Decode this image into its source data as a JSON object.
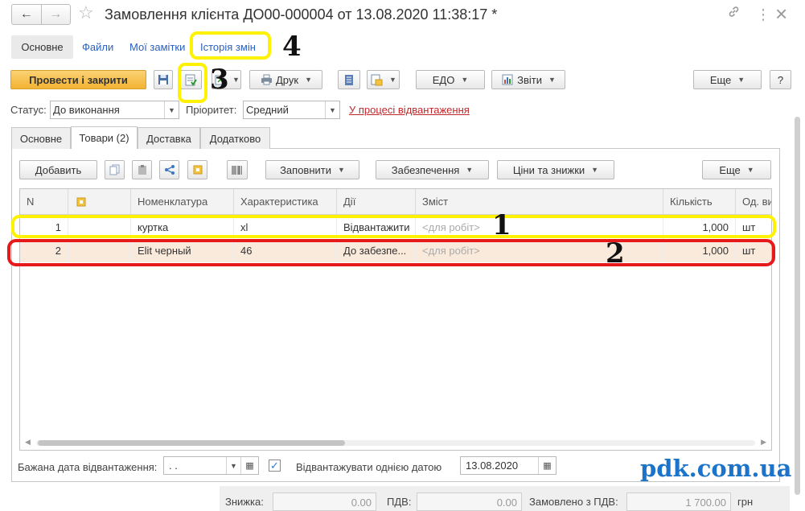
{
  "window": {
    "title": "Замовлення клієнта ДО00-000004 от 13.08.2020 11:38:17 *",
    "back_icon": "←",
    "forward_icon": "→",
    "star_icon": "☆",
    "link_icon": "🔗",
    "more_icon": "⋮",
    "close_icon": "×"
  },
  "panel_tabs": [
    {
      "label": "Основне"
    },
    {
      "label": "Файли"
    },
    {
      "label": "Мої замітки"
    },
    {
      "label": "Історія змін"
    }
  ],
  "toolbar": {
    "post_close": "Провести і закрити",
    "print": "Друк",
    "edo": "ЕДО",
    "reports": "Звіти",
    "more": "Еще",
    "help": "?"
  },
  "status_row": {
    "status_label": "Статус:",
    "status_value": "До виконання",
    "priority_label": "Пріоритет:",
    "priority_value": "Средний",
    "shipping_link": "У процесі відвантаження"
  },
  "form_tabs": [
    {
      "label": "Основне"
    },
    {
      "label": "Товари (2)"
    },
    {
      "label": "Доставка"
    },
    {
      "label": "Додатково"
    }
  ],
  "goods_toolbar": {
    "add": "Добавить",
    "fill": "Заповнити",
    "provision": "Забезпечення",
    "prices": "Ціни та знижки",
    "more": "Еще"
  },
  "table": {
    "columns": [
      "N",
      "",
      "Номенклатура",
      "Характеристика",
      "Дії",
      "Зміст",
      "Кількість",
      "Од. ви"
    ],
    "rows": [
      {
        "n": "1",
        "item": "куртка",
        "char": "xl",
        "action": "Відвантажити",
        "content": "<для робіт>",
        "qty": "1,000",
        "unit": "шт"
      },
      {
        "n": "2",
        "item": "Elit черный",
        "char": "46",
        "action": "До забезпе...",
        "content": "<для робіт>",
        "qty": "1,000",
        "unit": "шт"
      }
    ]
  },
  "footer": {
    "desired_date_label": "Бажана дата відвантаження:",
    "desired_date_value": " .  .",
    "ship_one_date_label": "Відвантажувати однією датою",
    "ship_one_date_checked": true,
    "ship_date_value": "13.08.2020"
  },
  "totals": {
    "discount_label": "Знижка:",
    "discount_value": "0.00",
    "vat_label": "ПДВ:",
    "vat_value": "0.00",
    "ordered_label": "Замовлено з ПДВ:",
    "ordered_value": "1 700.00",
    "currency": "грн"
  },
  "annotations": {
    "n1": "1",
    "n2": "2",
    "n3": "3",
    "n4": "4",
    "watermark": "pdk.com.ua"
  }
}
